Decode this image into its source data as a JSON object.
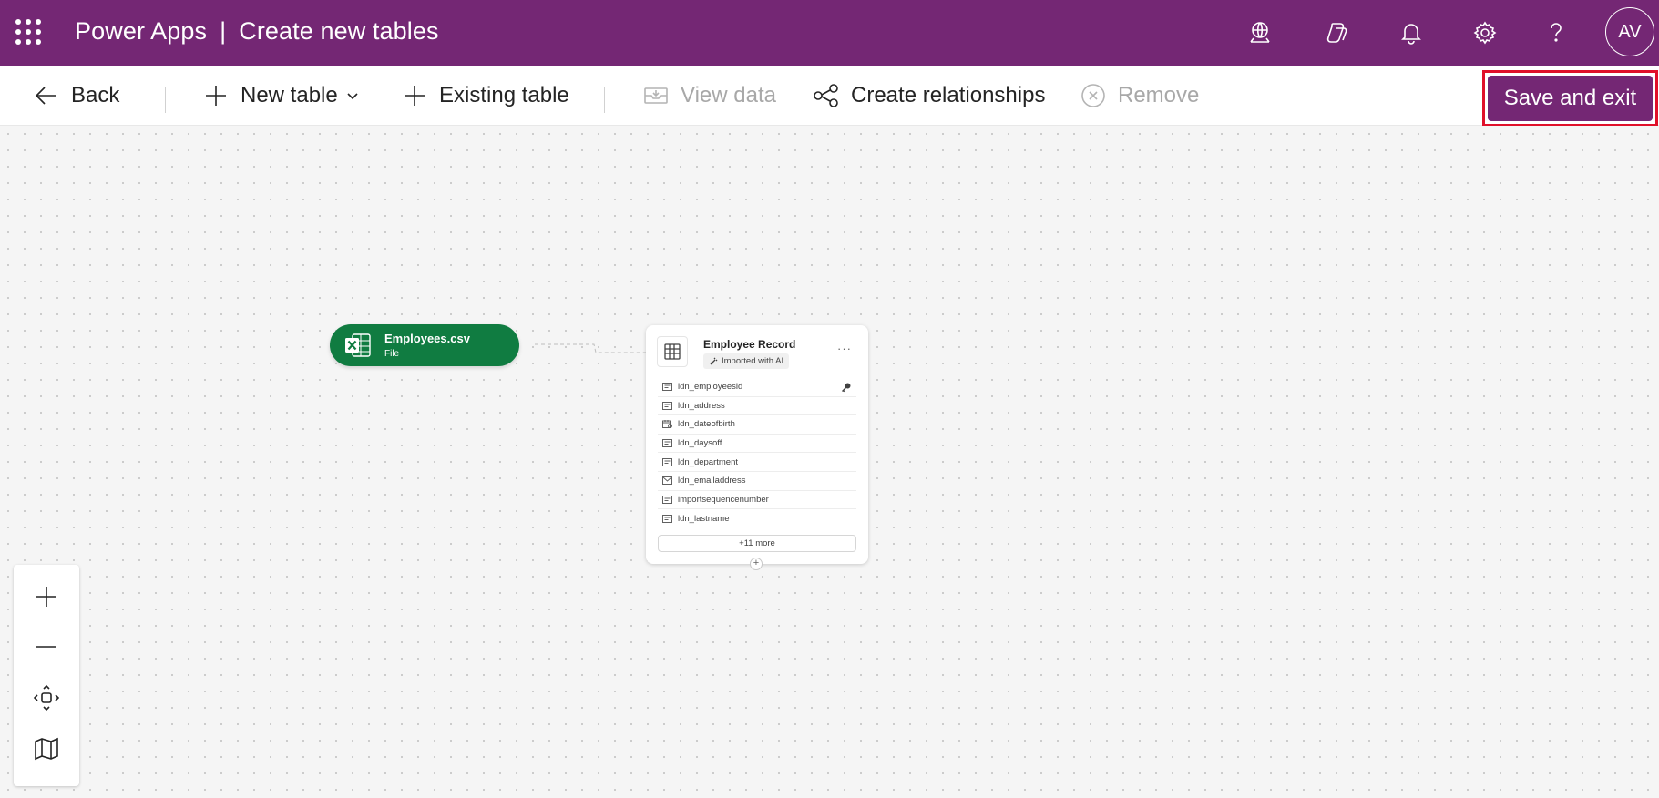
{
  "header": {
    "app_name": "Power Apps",
    "separator": "|",
    "page_title": "Create new tables",
    "avatar_initials": "AV",
    "background_color": "#742774"
  },
  "commands": {
    "back": "Back",
    "new_table": "New table",
    "existing_table": "Existing table",
    "view_data": "View data",
    "create_relationships": "Create relationships",
    "remove": "Remove",
    "save_and_exit": "Save and exit"
  },
  "file_node": {
    "name": "Employees.csv",
    "type": "File",
    "color": "#107c41"
  },
  "table_card": {
    "title": "Employee Record",
    "badge": "Imported with AI",
    "more_menu": "···",
    "columns": [
      {
        "name": "ldn_employeesid",
        "icon": "text-field-icon",
        "is_key": true
      },
      {
        "name": "ldn_address",
        "icon": "text-field-icon",
        "is_key": false
      },
      {
        "name": "ldn_dateofbirth",
        "icon": "calendar-field-icon",
        "is_key": false
      },
      {
        "name": "ldn_daysoff",
        "icon": "text-field-icon",
        "is_key": false
      },
      {
        "name": "ldn_department",
        "icon": "text-field-icon",
        "is_key": false
      },
      {
        "name": "ldn_emailaddress",
        "icon": "email-field-icon",
        "is_key": false
      },
      {
        "name": "importsequencenumber",
        "icon": "text-field-icon",
        "is_key": false
      },
      {
        "name": "ldn_lastname",
        "icon": "text-field-icon",
        "is_key": false
      }
    ],
    "more_columns": "+11 more",
    "add_symbol": "+"
  },
  "highlight_color": "#e0102a"
}
